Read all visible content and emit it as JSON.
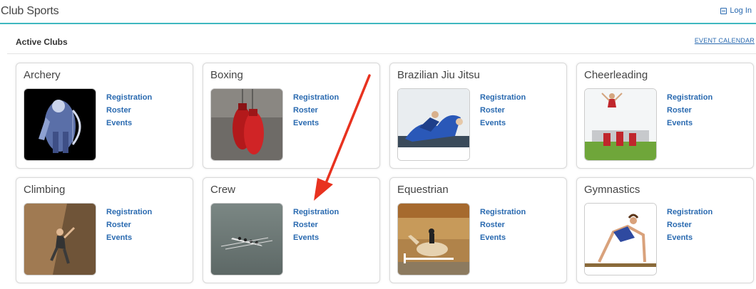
{
  "header": {
    "title": "Club Sports",
    "login_label": "Log In"
  },
  "section": {
    "title": "Active Clubs",
    "event_calendar_label": "EVENT CALENDAR"
  },
  "link_labels": {
    "registration": "Registration",
    "roster": "Roster",
    "events": "Events"
  },
  "clubs": [
    {
      "name": "Archery",
      "image_icon": "archer-robot-image"
    },
    {
      "name": "Boxing",
      "image_icon": "boxing-gloves-image"
    },
    {
      "name": "Brazilian Jiu Jitsu",
      "image_icon": "jiu-jitsu-image"
    },
    {
      "name": "Cheerleading",
      "image_icon": "cheerleading-image"
    },
    {
      "name": "Climbing",
      "image_icon": "rock-climbing-image"
    },
    {
      "name": "Crew",
      "image_icon": "rowing-boat-image"
    },
    {
      "name": "Equestrian",
      "image_icon": "horse-jump-image"
    },
    {
      "name": "Gymnastics",
      "image_icon": "gymnast-image"
    }
  ],
  "colors": {
    "accent": "#3fb8c0",
    "link": "#2a6ab0",
    "annotation_arrow": "#e8321f"
  }
}
